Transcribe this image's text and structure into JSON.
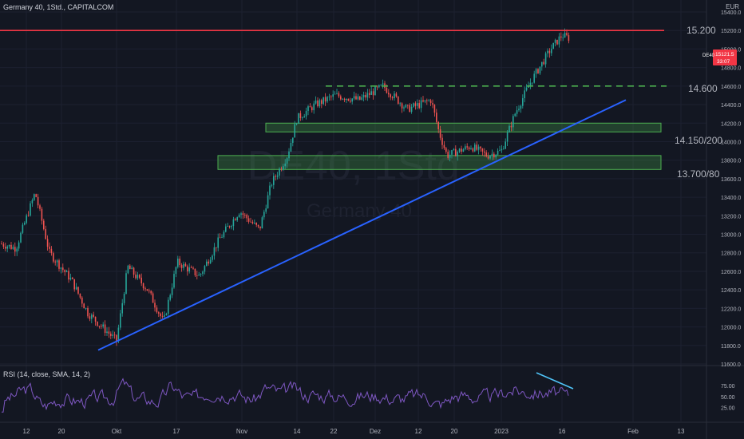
{
  "header": {
    "symbol_line": "Germany 40, 1Std., CAPITALCOM",
    "currency": "EUR"
  },
  "watermark": {
    "ticker": "DE40, 1Std.",
    "name": "Germany 40"
  },
  "price_tag": {
    "symbol": "DE40",
    "price": "15121.5",
    "countdown": "33:07"
  },
  "rsi": {
    "label": "RSI (14, close, SMA, 14, 2)",
    "ticks": [
      "75.00",
      "50.00",
      "25.00"
    ]
  },
  "colors": {
    "background": "#131722",
    "resistance_line": "#f23645",
    "trendline": "#2962ff",
    "support_zone": "#4caf50",
    "dashed_level": "#4caf50",
    "rsi_line": "#7e57c2",
    "rsi_divergence": "#4fc3f7"
  },
  "chart_data": {
    "type": "candlestick",
    "title": "Germany 40, 1Std., CAPITALCOM",
    "y_axis_unit": "EUR",
    "y_ticks": [
      "15400.0",
      "15200.0",
      "15000.0",
      "14800.0",
      "14600.0",
      "14400.0",
      "14200.0",
      "14000.0",
      "13800.0",
      "13600.0",
      "13400.0",
      "13200.0",
      "13000.0",
      "12800.0",
      "12600.0",
      "12400.0",
      "12200.0",
      "12000.0",
      "11800.0",
      "11600.0"
    ],
    "x_ticks": [
      "12",
      "20",
      "Okt",
      "17",
      "Nov",
      "14",
      "22",
      "Dez",
      "12",
      "20",
      "2023",
      "16",
      "Feb",
      "13"
    ],
    "levels": [
      {
        "label": "15.200",
        "value": 15200
      },
      {
        "label": "14.600",
        "value": 14600
      },
      {
        "label": "14.150/200",
        "low": 14150,
        "high": 14200
      },
      {
        "label": "13.700/80",
        "low": 13700,
        "high": 13850
      }
    ],
    "trendline": [
      {
        "x": "Okt",
        "y": 11750
      },
      {
        "x": "Feb",
        "y": 14450
      }
    ],
    "price_path": [
      {
        "x": "12",
        "y": 12900
      },
      {
        "x": "20",
        "y": 12400
      },
      {
        "x": "Okt",
        "y": 11800
      },
      {
        "x": "17",
        "y": 12100
      },
      {
        "x": "Nov",
        "y": 13100
      },
      {
        "x": "14",
        "y": 14200
      },
      {
        "x": "22",
        "y": 14500
      },
      {
        "x": "Dez",
        "y": 14600
      },
      {
        "x": "12",
        "y": 14450
      },
      {
        "x": "20",
        "y": 13800
      },
      {
        "x": "2023",
        "y": 14000
      },
      {
        "x": "16",
        "y": 15120
      }
    ]
  }
}
